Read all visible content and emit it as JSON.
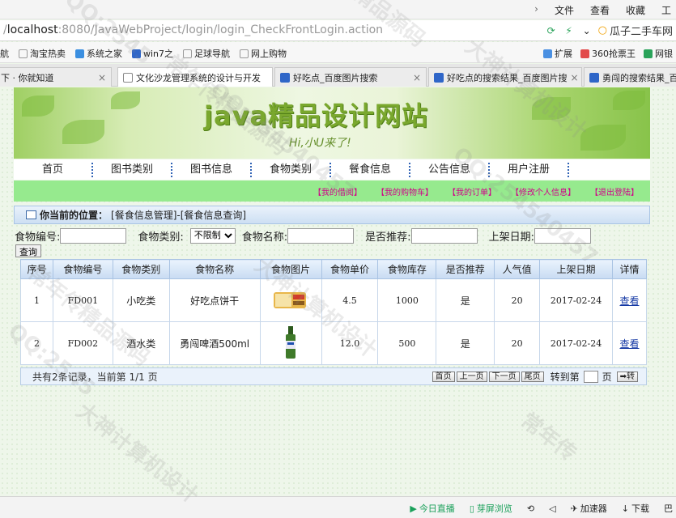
{
  "browser": {
    "menu": [
      "文件",
      "查看",
      "收藏",
      "工"
    ],
    "address": {
      "host": "localhost",
      "rest": ":8080/JavaWebProject/login/login_CheckFrontLogin.action"
    },
    "search_text": "瓜子二手车网",
    "favorites_left": [
      "航",
      "淘宝热卖",
      "系统之家",
      "win7之",
      "足球导航",
      "网上购物"
    ],
    "favorites_right": [
      "扩展",
      "360抢票王",
      "网银"
    ],
    "tabs": [
      {
        "title": "下 · 你就知道"
      },
      {
        "title": "文化沙龙管理系统的设计与开发"
      },
      {
        "title": "好吃点_百度图片搜索"
      },
      {
        "title": "好吃点的搜索结果_百度图片搜"
      },
      {
        "title": "勇闯的搜索结果_百度图片"
      }
    ]
  },
  "banner": {
    "title": "java精品设计网站",
    "subtitle": "Hi,小U来了!"
  },
  "nav": [
    "首页",
    "图书类别",
    "图书信息",
    "食物类别",
    "餐食信息",
    "公告信息",
    "用户注册"
  ],
  "user_links": [
    "【我的借阅】",
    "【我的购物车】",
    "【我的订单】",
    "【修改个人信息】",
    "【退出登陆】"
  ],
  "position": {
    "label": "你当前的位置：",
    "path": "[餐食信息管理]-[餐食信息查询]"
  },
  "filters": {
    "code_label": "食物编号:",
    "type_label": "食物类别:",
    "type_value": "不限制",
    "name_label": "食物名称:",
    "recommend_label": "是否推荐:",
    "date_label": "上架日期:",
    "query_button": "查询"
  },
  "table": {
    "headers": [
      "序号",
      "食物编号",
      "食物类别",
      "食物名称",
      "食物图片",
      "食物单价",
      "食物库存",
      "是否推荐",
      "人气值",
      "上架日期",
      "详情"
    ],
    "rows": [
      {
        "no": "1",
        "code": "FD001",
        "type": "小吃类",
        "name": "好吃点饼干",
        "price": "4.5",
        "stock": "1000",
        "recommend": "是",
        "popularity": "20",
        "date": "2017-02-24",
        "detail": "查看"
      },
      {
        "no": "2",
        "code": "FD002",
        "type": "酒水类",
        "name": "勇闯啤酒500ml",
        "price": "12.0",
        "stock": "500",
        "recommend": "是",
        "popularity": "20",
        "date": "2017-02-24",
        "detail": "查看"
      }
    ]
  },
  "pager": {
    "info": "共有2条记录，当前第 1/1 页",
    "first": "首页",
    "prev": "上一页",
    "next": "下一页",
    "last": "尾页",
    "goto": "转到第",
    "page_unit": "页",
    "go": "转"
  },
  "statusbar": [
    "今日直播",
    "芽屏浏览",
    "加速器",
    "下载",
    "巴"
  ],
  "watermarks": [
    "QQ:2545",
    "常年传精品源码",
    "大神计算机设计",
    "QQ:254540457",
    "常年传精品源码",
    "大神计算机设计",
    "QQ:254540457",
    "精品源码",
    "QQ:2545",
    "大神计算机设计",
    "常年传"
  ],
  "colors": {
    "nav_green": "#96ea8e",
    "user_link": "#d1008a",
    "link_blue": "#1438a4"
  }
}
